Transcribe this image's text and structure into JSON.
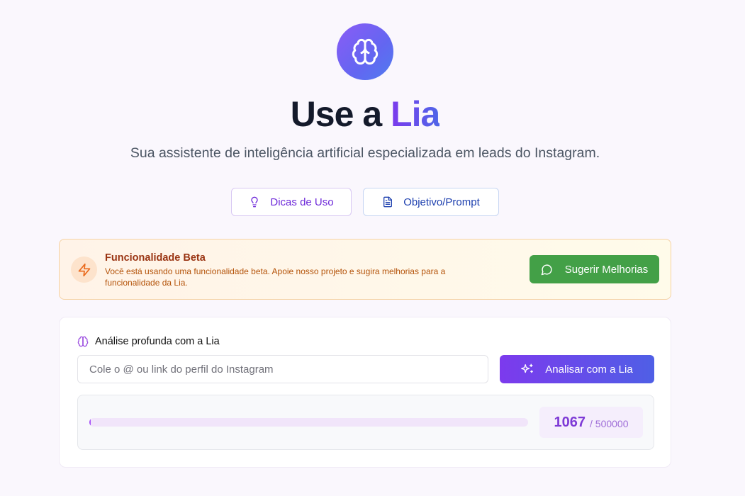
{
  "hero": {
    "title_prefix": "Use a ",
    "title_accent": "Lia",
    "subtitle": "Sua assistente de inteligência artificial especializada em leads do Instagram.",
    "logo_icon": "brain-icon",
    "accent_gradient": [
      "#8b5cf6",
      "#4f7cf0"
    ]
  },
  "actions": {
    "tips_label": "Dicas de Uso",
    "tips_icon": "lightbulb-icon",
    "prompt_label": "Objetivo/Prompt",
    "prompt_icon": "document-icon"
  },
  "beta_notice": {
    "title": "Funcionalidade Beta",
    "text": "Você está usando uma funcionalidade beta. Apoie nosso projeto e sugira melhorias para a funcionalidade da Lia.",
    "icon": "lightning-icon",
    "button_label": "Sugerir Melhorias",
    "button_icon": "chat-bubble-icon",
    "button_color": "#43a047"
  },
  "analysis": {
    "heading": "Análise profunda com a Lia",
    "heading_icon": "brain-icon",
    "input_placeholder": "Cole o @ ou link do perfil do Instagram",
    "input_value": "",
    "button_label": "Analisar com a Lia",
    "button_icon": "sparkles-icon"
  },
  "usage": {
    "count": "1067",
    "limit": "/ 500000",
    "used_fraction": 0.002134
  }
}
